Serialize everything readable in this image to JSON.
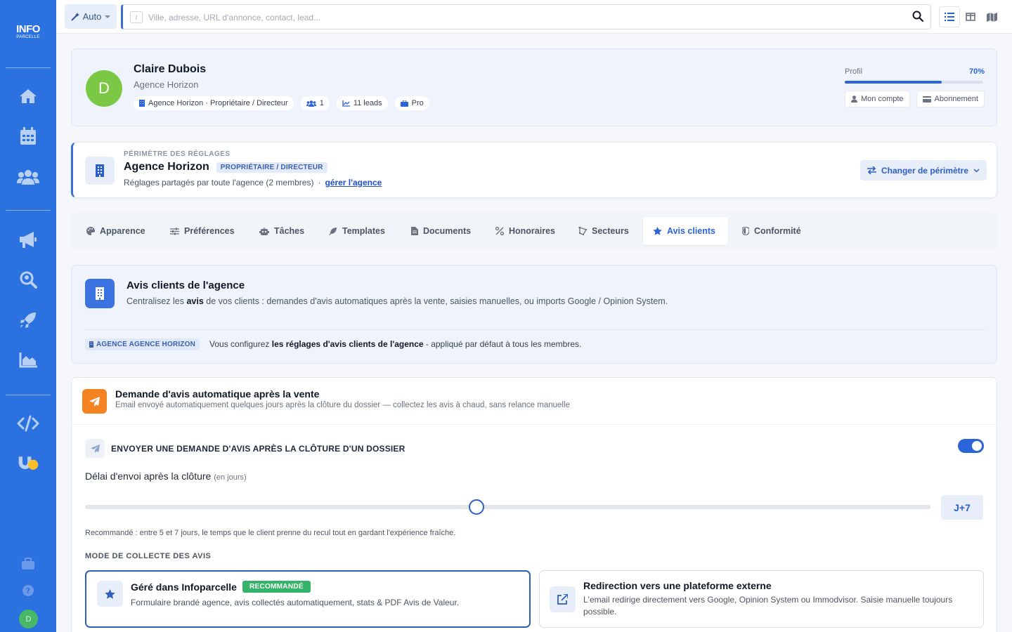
{
  "sidebar": {
    "logo_line1": "INFO",
    "logo_line2": "PARCELLE",
    "avatar_letter": "D"
  },
  "topbar": {
    "mode_label": "Auto",
    "search_shortcut": "/",
    "search_placeholder": "Ville, adresse, URL d'annonce, contact, lead..."
  },
  "profile": {
    "avatar_letter": "D",
    "name": "Claire Dubois",
    "agency": "Agence Horizon",
    "chips": {
      "role": "Agence Horizon · Propriétaire / Directeur",
      "members": "1",
      "leads": "11 leads",
      "plan": "Pro"
    },
    "progress_label": "Profil",
    "progress_value": "70%",
    "progress_fraction": 0.7,
    "account_button": "Mon compte",
    "subscription_button": "Abonnement"
  },
  "scope": {
    "kicker": "PÉRIMÈTRE DES RÉGLAGES",
    "title": "Agence Horizon",
    "role_badge": "PROPRIÉTAIRE / DIRECTEUR",
    "subtitle": "Réglages partagés par toute l'agence (2 membres)",
    "separator": "·",
    "manage_link": "gérer l'agence",
    "change_button": "Changer de périmètre"
  },
  "tabs": [
    {
      "label": "Apparence"
    },
    {
      "label": "Préférences"
    },
    {
      "label": "Tâches"
    },
    {
      "label": "Templates"
    },
    {
      "label": "Documents"
    },
    {
      "label": "Honoraires"
    },
    {
      "label": "Secteurs"
    },
    {
      "label": "Avis clients"
    },
    {
      "label": "Conformité"
    }
  ],
  "intro": {
    "title": "Avis clients de l'agence",
    "desc_before": "Centralisez les ",
    "desc_bold": "avis",
    "desc_after": " de vos clients : demandes d'avis automatiques après la vente, saisies manuelles, ou imports Google / Opinion System.",
    "agency_tag": "AGENCE AGENCE HORIZON",
    "note_before": "Vous configurez ",
    "note_bold": "les réglages d'avis clients de l'agence",
    "note_after": " - appliqué par défaut à tous les membres."
  },
  "auto_request": {
    "title": "Demande d'avis automatique après la vente",
    "desc": "Email envoyé automatiquement quelques jours après la clôture du dossier — collectez les avis à chaud, sans relance manuelle",
    "send_label": "ENVOYER UNE DEMANDE D'AVIS APRÈS LA CLÔTURE D'UN DOSSIER",
    "send_enabled": true,
    "delay_label": "Délai d'envoi après la clôture",
    "delay_unit": "(en jours)",
    "delay_fraction": 0.463,
    "delay_value": "J+7",
    "recommendation": "Recommandé : entre 5 et 7 jours, le temps que le client prenne du recul tout en gardant l'expérience fraîche.",
    "mode_label": "MODE DE COLLECTE DES AVIS",
    "modes": [
      {
        "title": "Géré dans Infoparcelle",
        "badge": "RECOMMANDÉ",
        "desc": "Formulaire brandé agence, avis collectés automatiquement, stats & PDF Avis de Valeur.",
        "selected": true
      },
      {
        "title": "Redirection vers une plateforme externe",
        "desc": "L'email redirige directement vers Google, Opinion System ou Immodvisor. Saisie manuelle toujours possible.",
        "selected": false
      }
    ]
  },
  "colors": {
    "sidebar": "#2b72e0",
    "accent": "#2b65d9",
    "success": "#34b36a",
    "warning": "#f58220"
  }
}
